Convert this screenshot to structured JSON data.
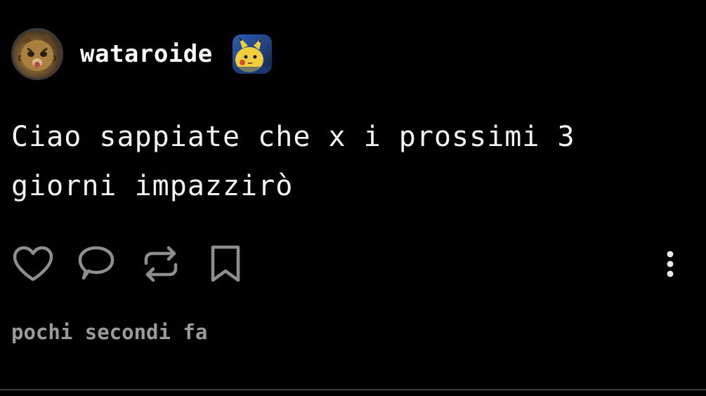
{
  "post": {
    "author": {
      "username": "wataroide",
      "avatar_icon": "cat-avatar-icon",
      "badge_icon": "pikachu-badge-icon"
    },
    "text_line_1": "Ciao sappiate che x i prossimi 3",
    "text_line_2": "giorni impazzirò",
    "actions": {
      "like_icon": "heart-icon",
      "reply_icon": "speech-bubble-icon",
      "repost_icon": "repost-icon",
      "bookmark_icon": "bookmark-icon",
      "more_icon": "more-vertical-icon"
    },
    "timestamp": "pochi secondi fa"
  },
  "colors": {
    "background": "#000000",
    "text": "#f2f2f2",
    "muted": "#9a9a9a",
    "icon": "#8e8e8e",
    "divider": "#3a3a3a"
  }
}
